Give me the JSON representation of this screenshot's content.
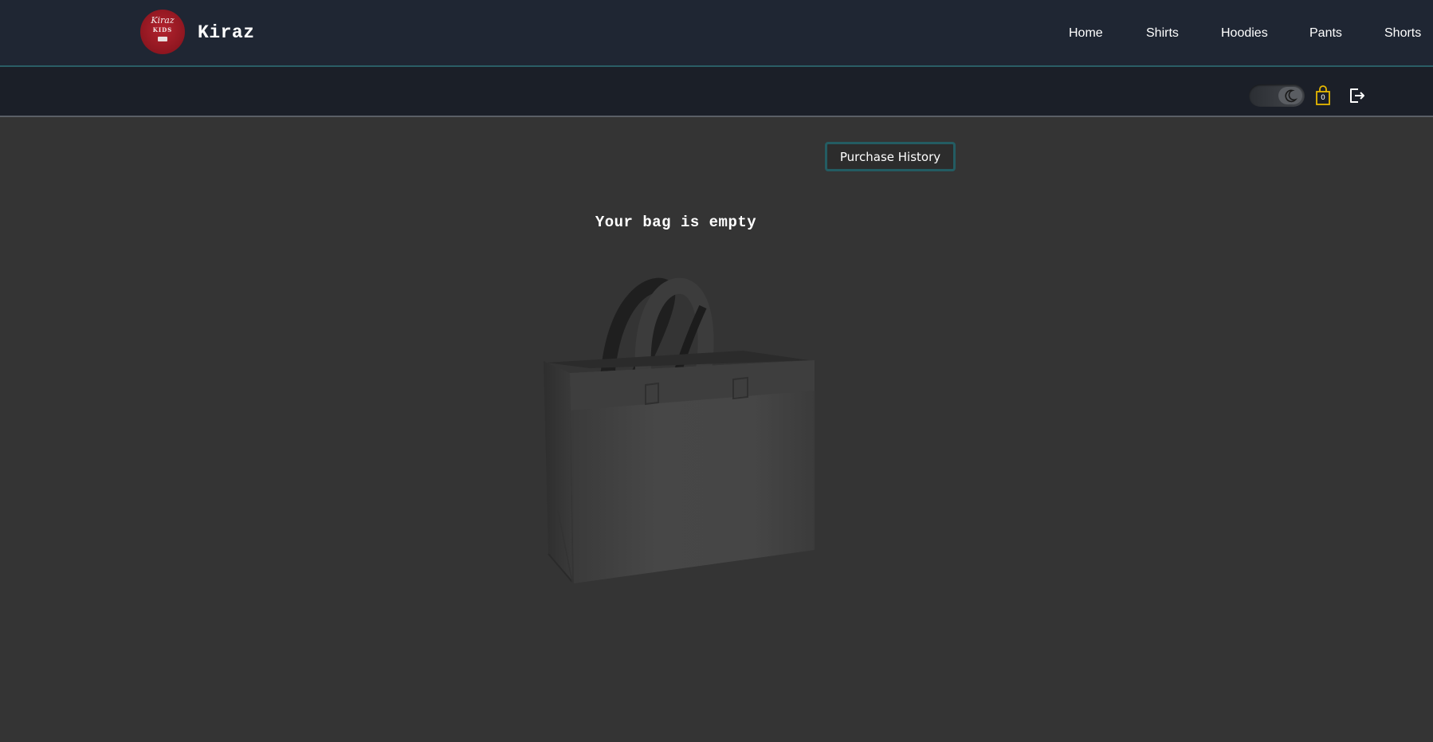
{
  "header": {
    "brand": "Kiraz",
    "logo_text": {
      "line1": "Kiraz",
      "line2": "KIDS"
    },
    "nav": [
      {
        "label": "Home"
      },
      {
        "label": "Shirts"
      },
      {
        "label": "Hoodies"
      },
      {
        "label": "Pants"
      },
      {
        "label": "Shorts"
      }
    ]
  },
  "toolbar": {
    "theme_toggle_icon": "moon-icon",
    "bag_icon": "shopping-bag-icon",
    "bag_count": "0",
    "logout_icon": "logout-icon"
  },
  "main": {
    "history_button": "Purchase History",
    "empty_message": "Your bag is empty",
    "illustration": "empty-shopping-bag"
  },
  "colors": {
    "background": "#343434",
    "header_bg": "#1f2633",
    "subbar_bg": "#1b1f28",
    "accent_teal": "#235c62",
    "bag_icon": "#e6b800",
    "logo_red": "#8e1620"
  }
}
